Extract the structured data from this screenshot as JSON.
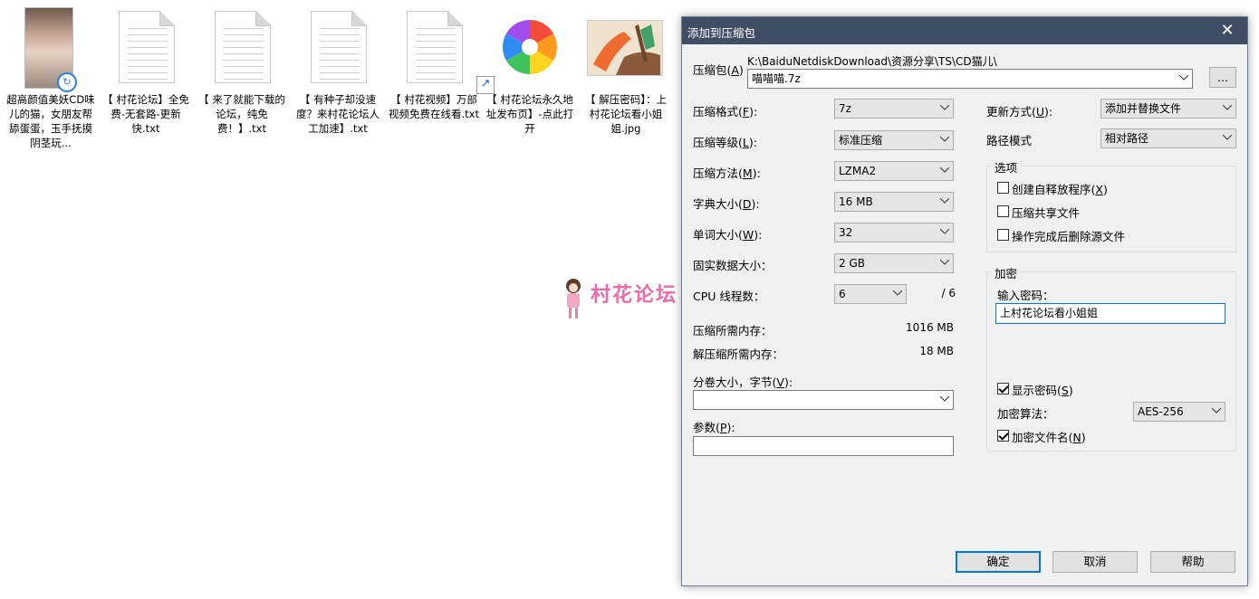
{
  "desktop": {
    "files": [
      {
        "label": "超高颜值美妖CD味儿的猫，女朋友帮舔蛋蛋，玉手抚摸阴茎玩...",
        "icon": "photo-icon"
      },
      {
        "label": "【 村花论坛】全免费-无套路-更新快.txt",
        "icon": "txt-file-icon"
      },
      {
        "label": "【 来了就能下载的论坛，纯免费！】.txt",
        "icon": "txt-file-icon"
      },
      {
        "label": "【 有种子却没速度？来村花论坛人工加速】.txt",
        "icon": "txt-file-icon"
      },
      {
        "label": "【 村花视频】万部视频免费在线看.txt",
        "icon": "txt-file-icon"
      },
      {
        "label": "【 村花论坛永久地址发布页】-点此打开",
        "icon": "pinwheel-shortcut-icon"
      },
      {
        "label": "【 解压密码】：上村花论坛看小姐姐.jpg",
        "icon": "paint-image-icon"
      }
    ],
    "watermark": {
      "text": "村花论坛"
    }
  },
  "dialog": {
    "title": "添加到压缩包",
    "close_glyph": "✕",
    "archive": {
      "label": "压缩包(A)",
      "label_main": "压缩包(",
      "label_key": "A",
      "label_end": ")",
      "path": "K:\\BaiduNetdiskDownload\\资源分享\\TS\\CD猫儿\\",
      "value": "喵喵喵.7z",
      "browse_label": "..."
    },
    "left_settings": [
      {
        "label_main": "压缩格式(",
        "key": "F",
        "label_end": "):",
        "value": "7z"
      },
      {
        "label_main": "压缩等级(",
        "key": "L",
        "label_end": "):",
        "value": "标准压缩"
      },
      {
        "label_main": "压缩方法(",
        "key": "M",
        "label_end": "):",
        "value": "LZMA2"
      },
      {
        "label_main": "字典大小(",
        "key": "D",
        "label_end": "):",
        "value": "16 MB"
      },
      {
        "label_main": "单词大小(",
        "key": "W",
        "label_end": "):",
        "value": "32"
      },
      {
        "label_main": "固实数据大小：",
        "key": "",
        "label_end": "",
        "value": "2 GB"
      }
    ],
    "cpu": {
      "label_main": "CPU 线程数：",
      "value": "6",
      "total": "/ 6"
    },
    "memory": {
      "compress_label": "压缩所需内存：",
      "compress_value": "1016 MB",
      "decompress_label": "解压缩所需内存：",
      "decompress_value": "18 MB"
    },
    "volume": {
      "label_main": "分卷大小，字节(",
      "key": "V",
      "label_end": "):",
      "value": ""
    },
    "params": {
      "label_main": "参数(",
      "key": "P",
      "label_end": "):",
      "value": ""
    },
    "update_mode": {
      "label_main": "更新方式(",
      "key": "U",
      "label_end": "):",
      "value": "添加并替换文件"
    },
    "path_mode": {
      "label": "路径模式",
      "value": "相对路径"
    },
    "options": {
      "title": "选项",
      "items": [
        {
          "label_main": "创建自释放程序(",
          "key": "X",
          "label_end": ")",
          "checked": false
        },
        {
          "label_main": "压缩共享文件",
          "key": "",
          "label_end": "",
          "checked": false
        },
        {
          "label_main": "操作完成后删除源文件",
          "key": "",
          "label_end": "",
          "checked": false
        }
      ]
    },
    "encryption": {
      "title": "加密",
      "password_label": "输入密码：",
      "password_value": "上村花论坛看小姐姐",
      "show_password": {
        "label_main": "显示密码(",
        "key": "S",
        "label_end": ")",
        "checked": true
      },
      "method_label": "加密算法：",
      "method_value": "AES-256",
      "encrypt_names": {
        "label_main": "加密文件名(",
        "key": "N",
        "label_end": ")",
        "checked": true
      }
    },
    "buttons": {
      "ok": "确定",
      "cancel": "取消",
      "help": "帮助"
    }
  }
}
